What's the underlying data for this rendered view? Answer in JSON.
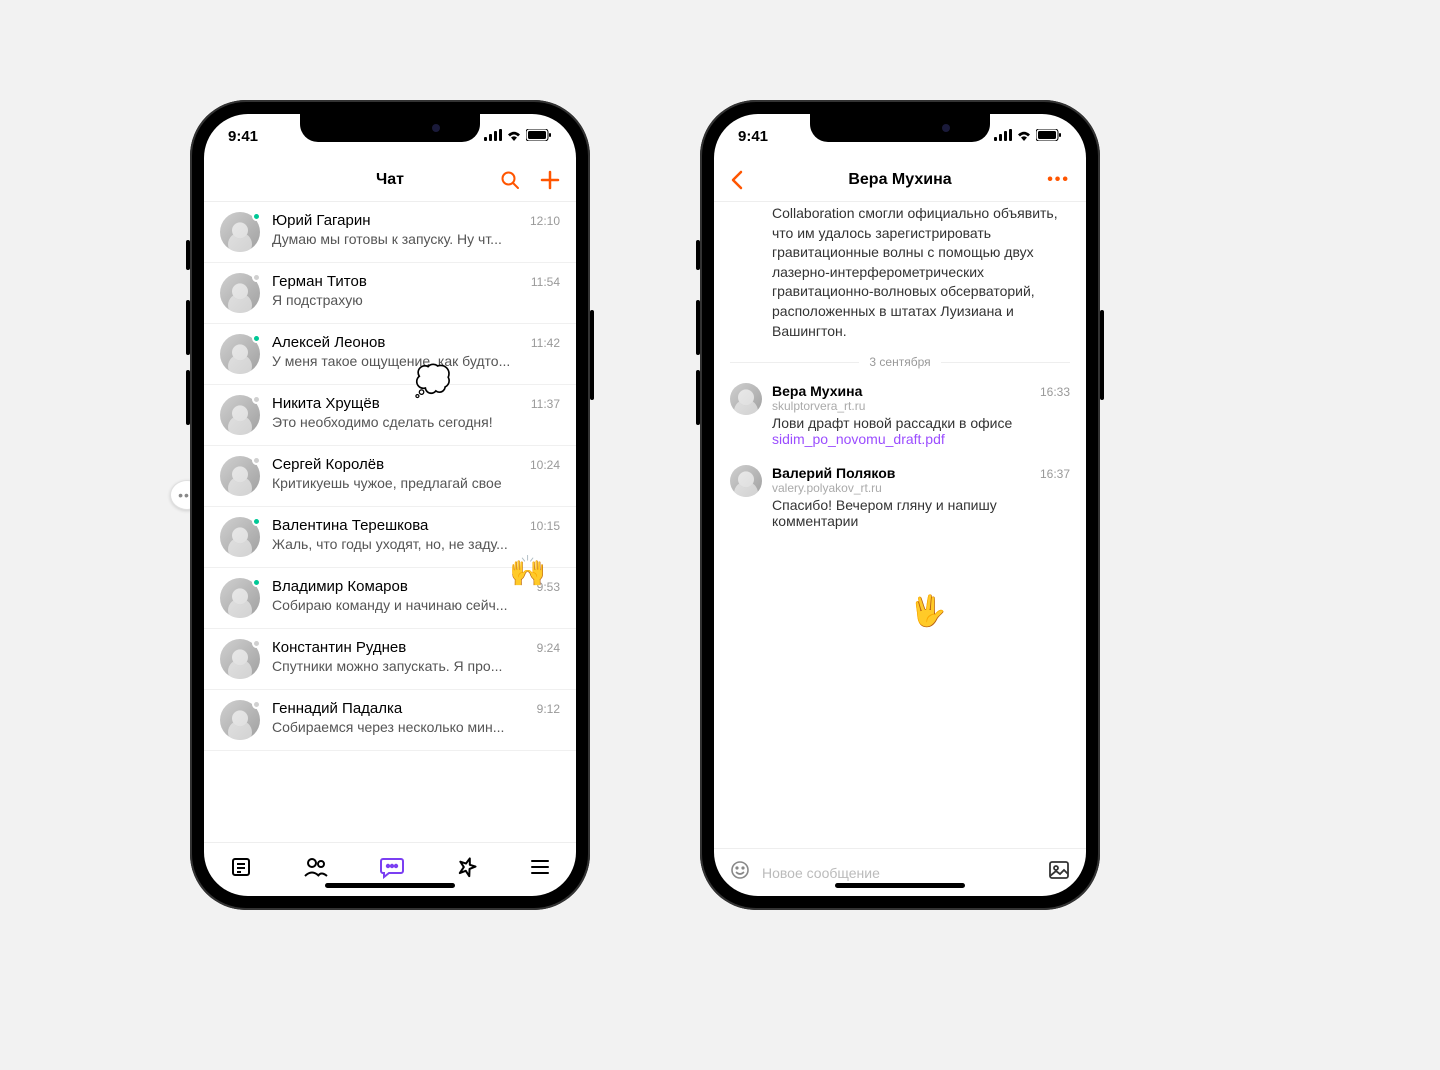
{
  "status": {
    "time": "9:41"
  },
  "accent": "#ff5500",
  "phone1": {
    "header_title": "Чат",
    "chats": [
      {
        "name": "Юрий Гагарин",
        "preview": "Думаю мы готовы к запуску. Ну чт...",
        "time": "12:10",
        "online": true
      },
      {
        "name": "Герман Титов",
        "preview": "Я подстрахую",
        "time": "11:54",
        "online": false
      },
      {
        "name": "Алексей Леонов",
        "preview": "У меня такое ощущение, как будто...",
        "time": "11:42",
        "online": true
      },
      {
        "name": "Никита Хрущёв",
        "preview": "Это необходимо сделать сегодня!",
        "time": "11:37",
        "online": false
      },
      {
        "name": "Сергей Королёв",
        "preview": "Критикуешь чужое, предлагай свое",
        "time": "10:24",
        "online": false
      },
      {
        "name": "Валентина Терешкова",
        "preview": "Жаль, что годы уходят, но, не заду...",
        "time": "10:15",
        "online": true
      },
      {
        "name": "Владимир Комаров",
        "preview": "Собираю команду и начинаю сейч...",
        "time": "9:53",
        "online": true
      },
      {
        "name": "Константин Руднев",
        "preview": "Спутники можно запускать. Я про...",
        "time": "9:24",
        "online": false
      },
      {
        "name": "Геннадий Падалка",
        "preview": "Собираемся через несколько мин...",
        "time": "9:12",
        "online": false
      }
    ]
  },
  "phone2": {
    "header_title": "Вера Мухина",
    "prev_message": "Collaboration смогли официально объявить, что им удалось зарегистрировать гравитационные волны с помощью двух лазерно-интерферометрических гравитационно-волновых обсерваторий, расположенных в штатах Луизиана и Вашингтон.",
    "date_separator": "3 сентября",
    "messages": [
      {
        "name": "Вера Мухина",
        "sub": "skulptorvera_rt.ru",
        "time": "16:33",
        "text": "Лови драфт новой рассадки в офисе",
        "attachment": "sidim_po_novomu_draft.pdf"
      },
      {
        "name": "Валерий Поляков",
        "sub": "valery.polyakov_rt.ru",
        "time": "16:37",
        "text": "Спасибо! Вечером гляну и напишу комментарии",
        "attachment": ""
      }
    ],
    "composer_placeholder": "Новое сообщение"
  }
}
